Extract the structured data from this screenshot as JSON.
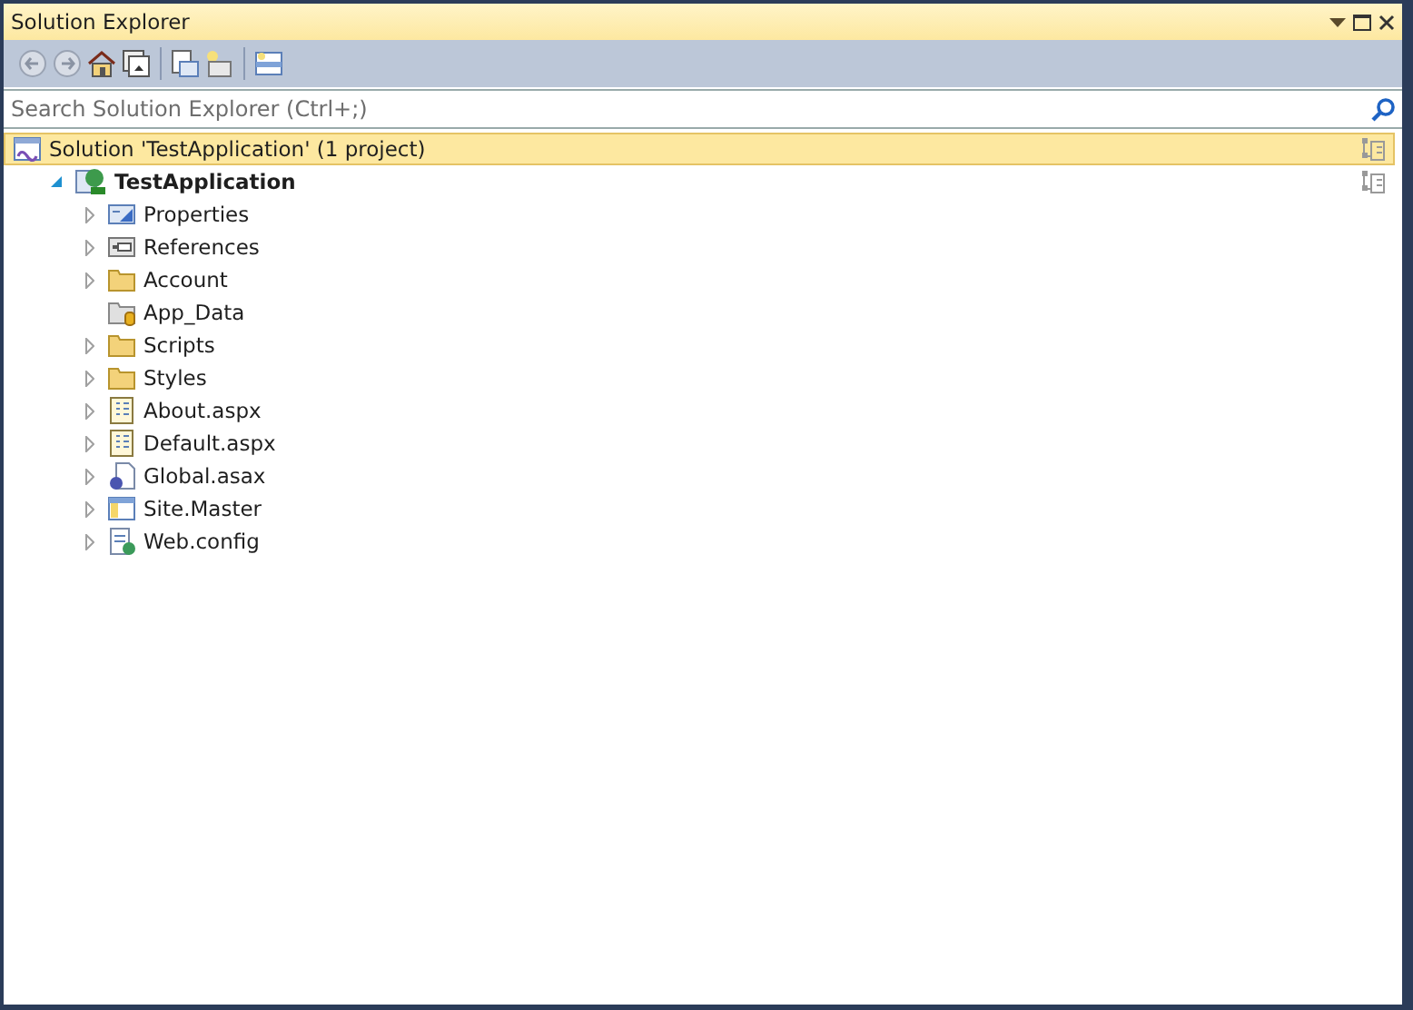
{
  "window": {
    "title": "Solution Explorer"
  },
  "search": {
    "placeholder": "Search Solution Explorer (Ctrl+;)"
  },
  "tree": [
    {
      "label": "Solution 'TestApplication' (1 project)",
      "kind": "solution",
      "selected": true,
      "children": [
        {
          "label": "TestApplication",
          "kind": "project",
          "selected": false,
          "bold": true,
          "expanded": true,
          "children": [
            {
              "label": "Properties",
              "kind": "properties",
              "selected": false,
              "expanded": false
            },
            {
              "label": "References",
              "kind": "references",
              "selected": false,
              "expanded": false
            },
            {
              "label": "Account",
              "kind": "folder",
              "selected": false,
              "expanded": false
            },
            {
              "label": "App_Data",
              "kind": "datafolder",
              "selected": false
            },
            {
              "label": "Scripts",
              "kind": "folder",
              "selected": false,
              "expanded": false
            },
            {
              "label": "Styles",
              "kind": "folder",
              "selected": false,
              "expanded": false
            },
            {
              "label": "About.aspx",
              "kind": "page",
              "selected": false,
              "expanded": false
            },
            {
              "label": "Default.aspx",
              "kind": "page",
              "selected": false,
              "expanded": false
            },
            {
              "label": "Global.asax",
              "kind": "global",
              "selected": false,
              "expanded": false
            },
            {
              "label": "Site.Master",
              "kind": "master",
              "selected": false,
              "expanded": false
            },
            {
              "label": "Web.config",
              "kind": "config",
              "selected": false,
              "expanded": false
            }
          ]
        }
      ]
    }
  ]
}
